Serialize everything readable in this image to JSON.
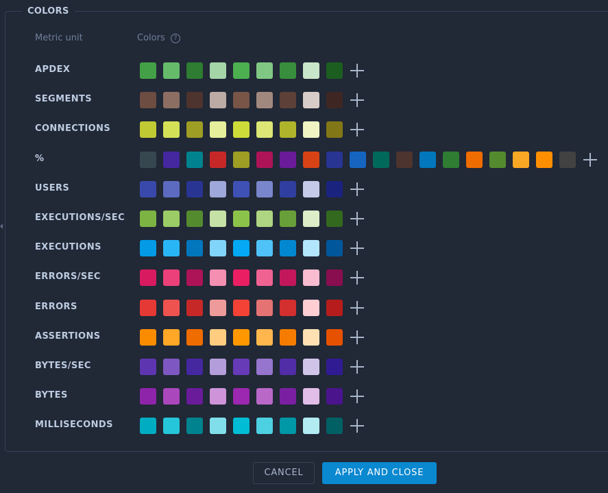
{
  "section": {
    "title": "COLORS"
  },
  "header": {
    "metric_unit": "Metric unit",
    "colors": "Colors",
    "help_icon": "?"
  },
  "rows": [
    {
      "label": "APDEX",
      "colors": [
        "#43a047",
        "#66bb6a",
        "#2e7d32",
        "#a5d6a7",
        "#4caf50",
        "#81c784",
        "#388e3c",
        "#c8e6c9",
        "#1b5e20"
      ]
    },
    {
      "label": "SEGMENTS",
      "colors": [
        "#6d4c41",
        "#8d6e63",
        "#4e342e",
        "#bcaaa4",
        "#795548",
        "#a1887f",
        "#5d4037",
        "#d7ccc8",
        "#3e2723"
      ]
    },
    {
      "label": "CONNECTIONS",
      "colors": [
        "#c0ca33",
        "#d4e157",
        "#9e9d24",
        "#e6ee9c",
        "#cddc39",
        "#dce775",
        "#afb42b",
        "#f0f4c3",
        "#827717"
      ]
    },
    {
      "label": "%",
      "colors": [
        "#37474f",
        "#4527a0",
        "#00838f",
        "#c62828",
        "#9e9d24",
        "#ad1457",
        "#6a1b9a",
        "#d84315",
        "#283593",
        "#1565c0",
        "#00695c",
        "#4e342e",
        "#0277bd",
        "#2e7d32",
        "#ef6c00",
        "#558b2f",
        "#f9a825",
        "#ff8f00",
        "#424242"
      ]
    },
    {
      "label": "USERS",
      "colors": [
        "#3949ab",
        "#5c6bc0",
        "#283593",
        "#9fa8da",
        "#3f51b5",
        "#7986cb",
        "#303f9f",
        "#c5cae9",
        "#1a237e"
      ]
    },
    {
      "label": "EXECUTIONS/SEC",
      "colors": [
        "#7cb342",
        "#9ccc65",
        "#558b2f",
        "#c5e1a5",
        "#8bc34a",
        "#aed581",
        "#689f38",
        "#dcedc8",
        "#33691e"
      ]
    },
    {
      "label": "EXECUTIONS",
      "colors": [
        "#039be5",
        "#29b6f6",
        "#0277bd",
        "#81d4fa",
        "#03a9f4",
        "#4fc3f7",
        "#0288d1",
        "#b3e5fc",
        "#01579b"
      ]
    },
    {
      "label": "ERRORS/SEC",
      "colors": [
        "#d81b60",
        "#ec407a",
        "#ad1457",
        "#f48fb1",
        "#e91e63",
        "#f06292",
        "#c2185b",
        "#f8bbd0",
        "#880e4f"
      ]
    },
    {
      "label": "ERRORS",
      "colors": [
        "#e53935",
        "#ef5350",
        "#c62828",
        "#ef9a9a",
        "#f44336",
        "#e57373",
        "#d32f2f",
        "#ffcdd2",
        "#b71c1c"
      ]
    },
    {
      "label": "ASSERTIONS",
      "colors": [
        "#fb8c00",
        "#ffa726",
        "#ef6c00",
        "#ffcc80",
        "#ff9800",
        "#ffb74d",
        "#f57c00",
        "#ffe0b2",
        "#e65100"
      ]
    },
    {
      "label": "BYTES/SEC",
      "colors": [
        "#5e35b1",
        "#7e57c2",
        "#4527a0",
        "#b39ddb",
        "#673ab7",
        "#9575cd",
        "#512da8",
        "#d1c4e9",
        "#311b92"
      ]
    },
    {
      "label": "BYTES",
      "colors": [
        "#8e24aa",
        "#ab47bc",
        "#6a1b9a",
        "#ce93d8",
        "#9c27b0",
        "#ba68c8",
        "#7b1fa2",
        "#e1bee7",
        "#4a148c"
      ]
    },
    {
      "label": "MILLISECONDS",
      "colors": [
        "#00acc1",
        "#26c6da",
        "#00838f",
        "#80deea",
        "#00bcd4",
        "#4dd0e1",
        "#0097a7",
        "#b2ebf2",
        "#006064"
      ]
    }
  ],
  "footer": {
    "cancel_label": "CANCEL",
    "apply_label": "APPLY AND CLOSE"
  }
}
